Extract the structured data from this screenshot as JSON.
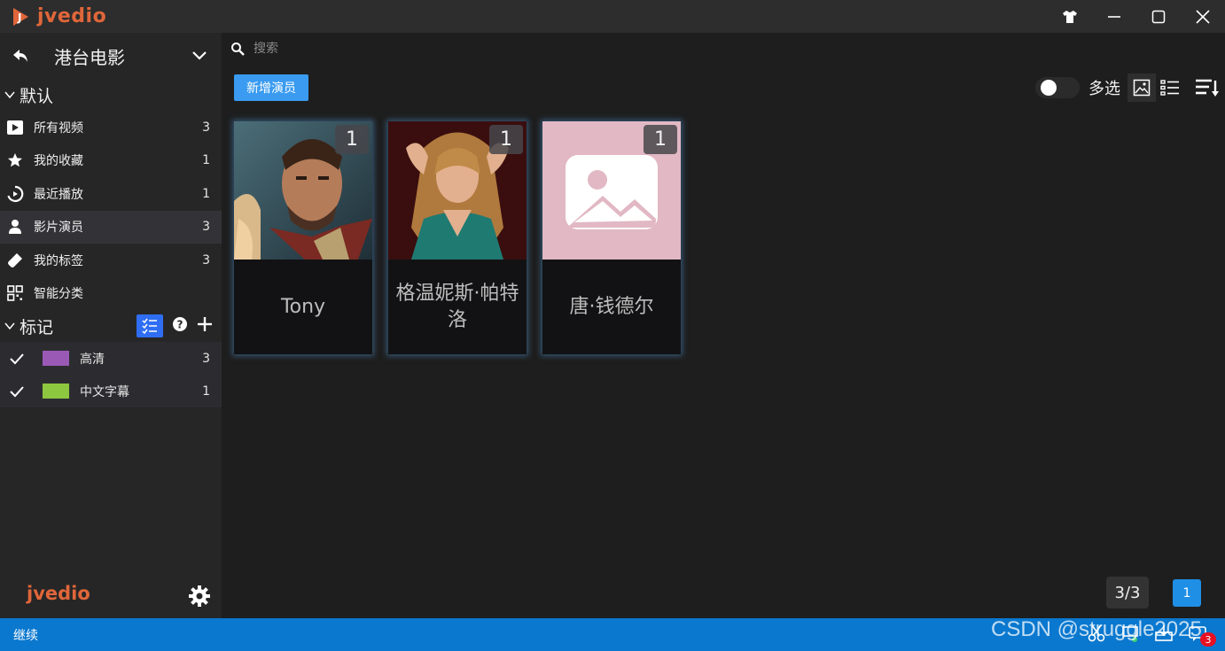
{
  "window": {
    "title": "jvedio"
  },
  "colors": {
    "accent": "#3a9bf0",
    "brand": "#e0663a",
    "statusbar": "#0a78cf",
    "tag_hd": "#9b59b6",
    "tag_cn": "#8dc63f",
    "placeholder_bg": "#e1b8c4"
  },
  "sidebar": {
    "library_title": "港台电影",
    "default_group": "默认",
    "items": [
      {
        "label": "所有视频",
        "count": "3",
        "icon": "play-icon"
      },
      {
        "label": "我的收藏",
        "count": "1",
        "icon": "star-icon"
      },
      {
        "label": "最近播放",
        "count": "1",
        "icon": "history-icon"
      },
      {
        "label": "影片演员",
        "count": "3",
        "icon": "person-icon"
      },
      {
        "label": "我的标签",
        "count": "3",
        "icon": "tag-icon"
      },
      {
        "label": "智能分类",
        "count": "",
        "icon": "grid-icon"
      }
    ],
    "marks_group": "标记",
    "tags": [
      {
        "label": "高清",
        "count": "3"
      },
      {
        "label": "中文字幕",
        "count": "1"
      }
    ],
    "footer_logo": "jvedio"
  },
  "main": {
    "search_placeholder": "搜索",
    "add_actor_label": "新增演员",
    "multi_select_label": "多选",
    "actors": [
      {
        "name": "Tony",
        "count": "1"
      },
      {
        "name": "格温妮斯·帕特洛",
        "count": "1"
      },
      {
        "name": "唐·钱德尔",
        "count": "1"
      }
    ],
    "page_info": "3/3",
    "current_page": "1"
  },
  "statusbar": {
    "text": "继续",
    "notification_count": "3"
  },
  "watermark": "CSDN @struggle2025"
}
